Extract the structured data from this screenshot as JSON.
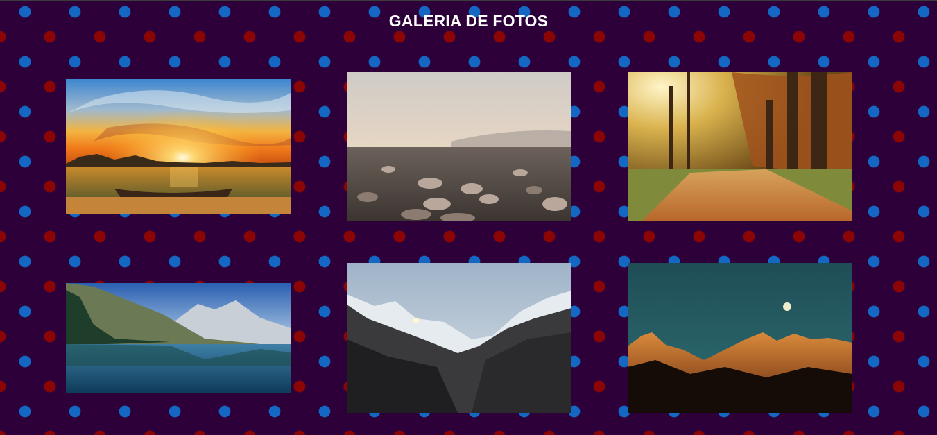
{
  "header": {
    "title": "GALERIA DE FOTOS"
  },
  "colors": {
    "background": "#2e0039",
    "dot_blue": "#1467c3",
    "dot_red": "#8b0505",
    "title_text": "#ffffff"
  },
  "gallery": {
    "photos": [
      {
        "subject": "sunset-over-lake-with-boat"
      },
      {
        "subject": "pebbles-on-beach"
      },
      {
        "subject": "autumn-tree-lined-path"
      },
      {
        "subject": "mountain-lake-reflection"
      },
      {
        "subject": "snowy-mountain-valley"
      },
      {
        "subject": "mountains-at-night-with-moon"
      }
    ]
  }
}
